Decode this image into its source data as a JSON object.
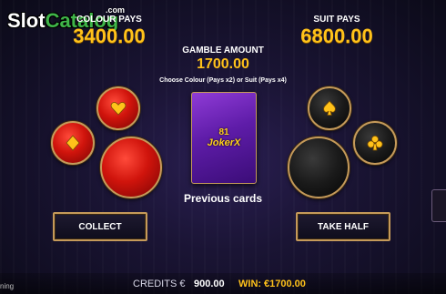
{
  "branding": {
    "logo_part1": "Slot",
    "logo_part2": "Catalog",
    "domain": ".com"
  },
  "header": {
    "colour_pays_label": "COLOUR PAYS",
    "colour_pays_value": "3400.00",
    "suit_pays_label": "SUIT PAYS",
    "suit_pays_value": "6800.00",
    "gamble_amount_label": "GAMBLE AMOUNT",
    "gamble_amount_value": "1700.00",
    "instructions": "Choose Colour (Pays x2) or Suit (Pays x4)"
  },
  "card": {
    "logo_line1": "81",
    "logo_line2": "JokerX"
  },
  "suits": {
    "hearts": "hearts-icon",
    "diamonds": "diamonds-icon",
    "spades": "spades-icon",
    "clubs": "clubs-icon"
  },
  "colors": {
    "red_button": "red-icon",
    "black_button": "black-icon",
    "accent_gold": "#ffc21a",
    "frame_gold": "#c59a5a"
  },
  "previous_cards_label": "Previous cards",
  "actions": {
    "collect": "COLLECT",
    "take_half": "TAKE HALF"
  },
  "footer": {
    "credits_label": "CREDITS €",
    "credits_value": "900.00",
    "win_label": "WIN:",
    "win_value": "€1700.00",
    "corner_text": "ning"
  }
}
